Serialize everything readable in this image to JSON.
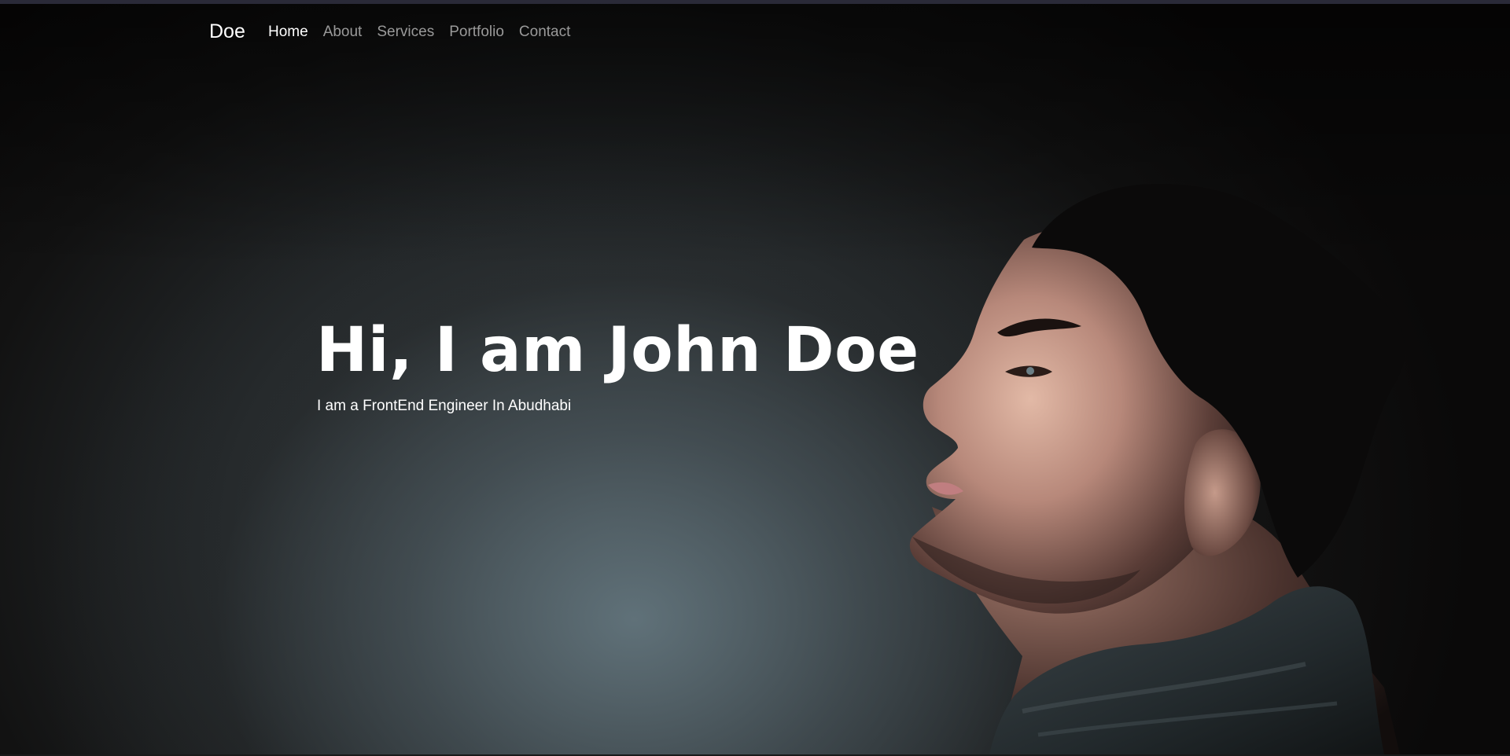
{
  "nav": {
    "brand": "Doe",
    "items": [
      {
        "label": "Home",
        "active": true
      },
      {
        "label": "About",
        "active": false
      },
      {
        "label": "Services",
        "active": false
      },
      {
        "label": "Portfolio",
        "active": false
      },
      {
        "label": "Contact",
        "active": false
      }
    ]
  },
  "hero": {
    "title": "Hi, I am John Doe",
    "subtitle": "I am a FrontEnd Engineer In Abudhabi",
    "portrait_icon": "portrait-illustration"
  },
  "colors": {
    "text": "#ffffff",
    "nav_inactive": "#9a9a9a",
    "background_dark": "#0b0a0a",
    "background_light": "#5c6d74"
  }
}
